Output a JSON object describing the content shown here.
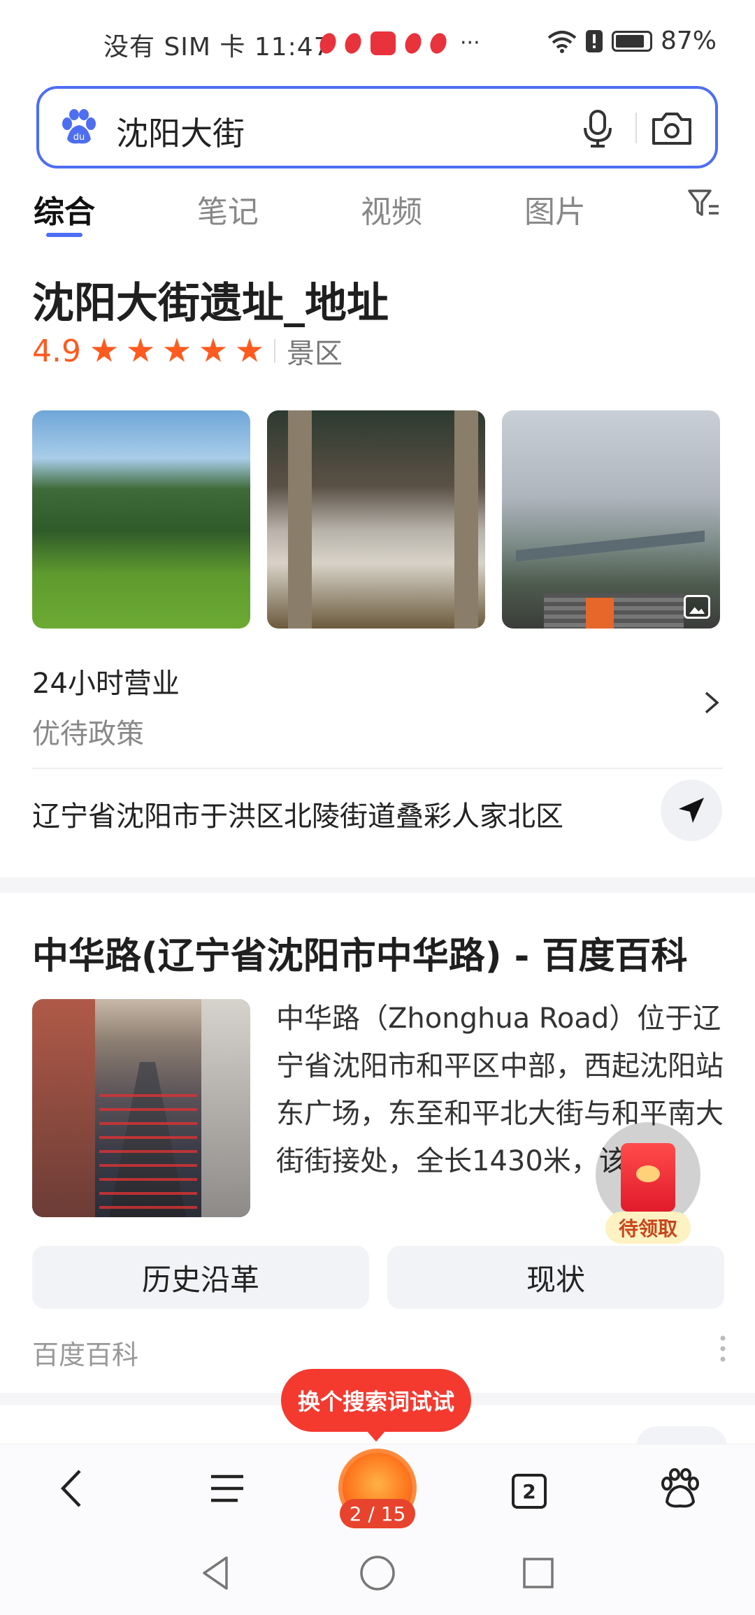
{
  "status_bar": {
    "carrier_time": "没有 SIM 卡 11:47",
    "more": "···",
    "battery": "87%"
  },
  "search": {
    "query": "沈阳大街",
    "logo_icon": "baidu-paw-icon",
    "mic_icon": "mic-icon",
    "camera_icon": "camera-icon"
  },
  "tabs": [
    {
      "label": "综合",
      "active": true
    },
    {
      "label": "笔记"
    },
    {
      "label": "视频"
    },
    {
      "label": "图片"
    }
  ],
  "place_card": {
    "title": "沈阳大街遗址_地址",
    "rating": "4.9",
    "stars": 5,
    "category": "景区",
    "hours": "24小时营业",
    "policy": "优待政策",
    "address": "辽宁省沈阳市于洪区北陵街道叠彩人家北区"
  },
  "baike_card": {
    "title": "中华路(辽宁省沈阳市中华路) - 百度百科",
    "summary": "中华路（Zhonghua Road）位于辽宁省沈阳市和平区中部，西起沈阳站东广场，东至和平北大街与和平南大街街接处，全长1430米，该...",
    "chips": [
      "历史沿革",
      "现状"
    ],
    "source": "百度百科"
  },
  "floating": {
    "red_packet_label": "待领取",
    "bubble": "换个搜索词试试"
  },
  "toolbar": {
    "page_counter": "2 / 15",
    "tabs_count": "2"
  },
  "colors": {
    "accent": "#4e6ef2",
    "rating": "#ff5a1f",
    "bubble": "#f4392f"
  }
}
